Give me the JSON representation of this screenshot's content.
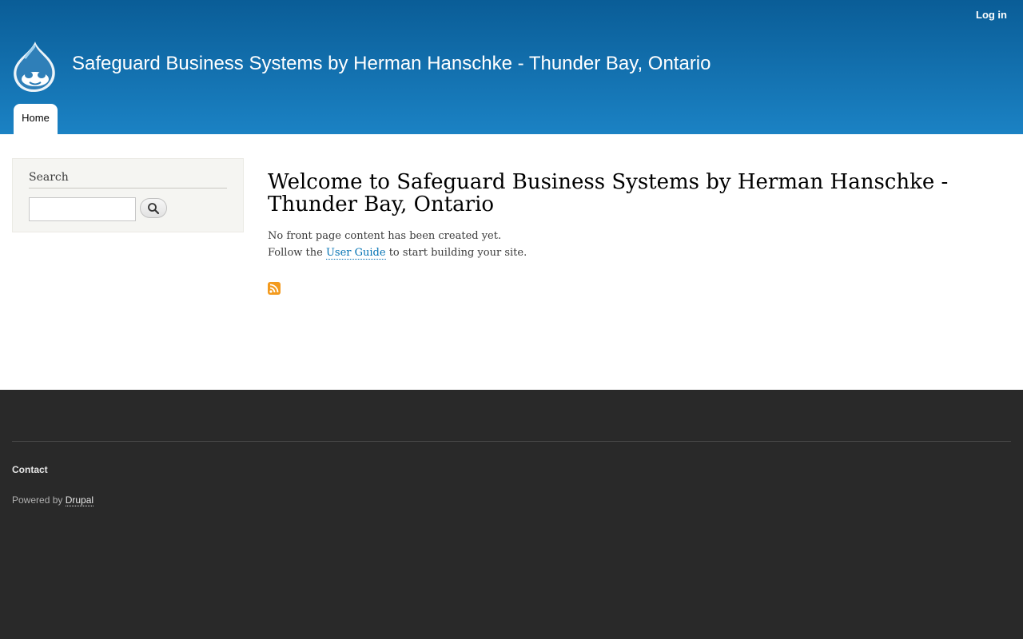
{
  "header": {
    "login_label": "Log in",
    "site_name": "Safeguard Business Systems by Herman Hanschke - Thunder Bay, Ontario",
    "logo_icon": "drupal-drop-logo",
    "nav": {
      "home_label": "Home"
    }
  },
  "sidebar": {
    "search": {
      "title": "Search",
      "value": "",
      "button_icon": "magnifier-icon"
    }
  },
  "content": {
    "title": "Welcome to Safeguard Business Systems by Herman Hanschke - Thunder Bay, Ontario",
    "line1": "No front page content has been created yet.",
    "line2_prefix": "Follow the ",
    "line2_link": "User Guide",
    "line2_suffix": " to start building your site.",
    "feed_icon": "rss-feed-icon"
  },
  "footer": {
    "contact_label": "Contact",
    "powered_by_prefix": "Powered by ",
    "powered_by_link": "Drupal"
  },
  "colors": {
    "header_top": "#0a5d97",
    "header_bottom": "#1b82c4",
    "footer_bg": "#292929",
    "link": "#0071b3",
    "rss": "#f39a1d"
  }
}
